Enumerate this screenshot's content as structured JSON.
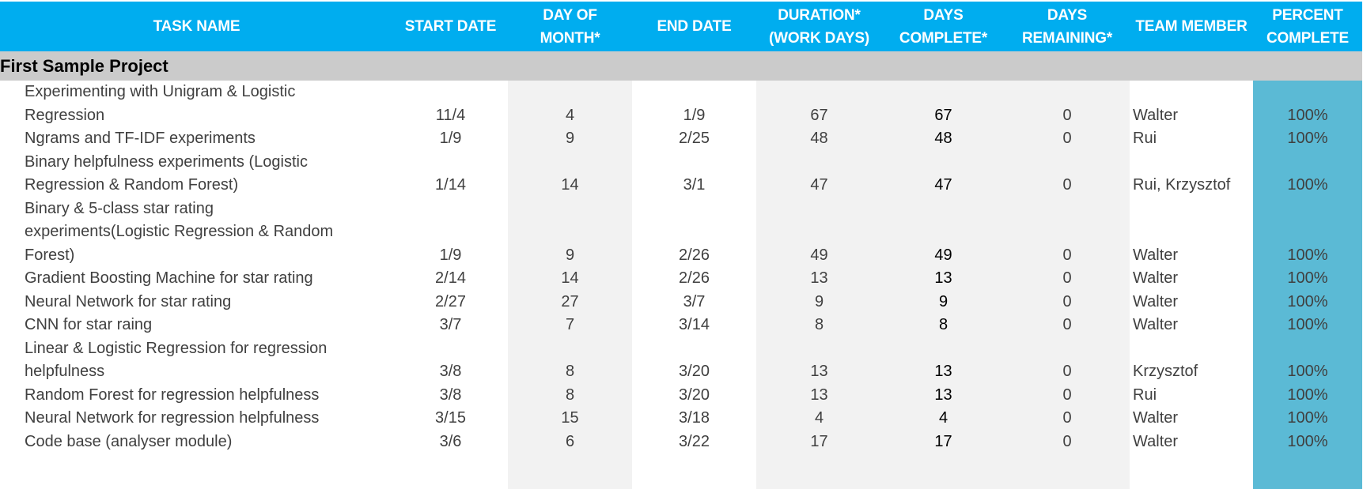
{
  "colors": {
    "header_bg": "#00adef",
    "project_row_bg": "#cbcbcb",
    "stripe_gray": "#f2f2f2",
    "percent_column_bg": "#5bbad5"
  },
  "columns": [
    {
      "key": "task",
      "label": "TASK NAME"
    },
    {
      "key": "start",
      "label": "START DATE"
    },
    {
      "key": "day",
      "label": "DAY OF MONTH*"
    },
    {
      "key": "end",
      "label": "END DATE"
    },
    {
      "key": "duration",
      "label": "DURATION* (WORK DAYS)"
    },
    {
      "key": "complete",
      "label": "DAYS COMPLETE*"
    },
    {
      "key": "remaining",
      "label": "DAYS REMAINING*"
    },
    {
      "key": "member",
      "label": "TEAM MEMBER"
    },
    {
      "key": "percent",
      "label": "PERCENT COMPLETE"
    }
  ],
  "header_lines": {
    "task": [
      "TASK NAME"
    ],
    "start": [
      "START DATE"
    ],
    "day": [
      "DAY OF",
      "MONTH*"
    ],
    "end": [
      "END DATE"
    ],
    "duration": [
      "DURATION*",
      "(WORK DAYS)"
    ],
    "complete": [
      "DAYS",
      "COMPLETE*"
    ],
    "remaining": [
      "DAYS",
      "REMAINING*"
    ],
    "member": [
      "TEAM MEMBER"
    ],
    "percent": [
      "PERCENT",
      "COMPLETE"
    ]
  },
  "project": {
    "title": "First Sample Project"
  },
  "tasks": [
    {
      "task_lines": [
        "Experimenting with Unigram & Logistic",
        "Regression"
      ],
      "start": "11/4",
      "day": "4",
      "end": "1/9",
      "duration": "67",
      "complete": "67",
      "remaining": "0",
      "member": "Walter",
      "percent": "100%"
    },
    {
      "task_lines": [
        "Ngrams and TF-IDF experiments"
      ],
      "start": "1/9",
      "day": "9",
      "end": "2/25",
      "duration": "48",
      "complete": "48",
      "remaining": "0",
      "member": "Rui",
      "percent": "100%"
    },
    {
      "task_lines": [
        "Binary helpfulness experiments (Logistic",
        "Regression & Random Forest)"
      ],
      "start": "1/14",
      "day": "14",
      "end": "3/1",
      "duration": "47",
      "complete": "47",
      "remaining": "0",
      "member": "Rui, Krzysztof",
      "percent": "100%"
    },
    {
      "task_lines": [
        "Binary & 5-class star rating",
        "experiments(Logistic Regression & Random",
        "Forest)"
      ],
      "start": "1/9",
      "day": "9",
      "end": "2/26",
      "duration": "49",
      "complete": "49",
      "remaining": "0",
      "member": "Walter",
      "percent": "100%"
    },
    {
      "task_lines": [
        "Gradient Boosting Machine for star rating"
      ],
      "start": "2/14",
      "day": "14",
      "end": "2/26",
      "duration": "13",
      "complete": "13",
      "remaining": "0",
      "member": "Walter",
      "percent": "100%"
    },
    {
      "task_lines": [
        "Neural Network for star rating"
      ],
      "start": "2/27",
      "day": "27",
      "end": "3/7",
      "duration": "9",
      "complete": "9",
      "remaining": "0",
      "member": "Walter",
      "percent": "100%"
    },
    {
      "task_lines": [
        "CNN for star raing"
      ],
      "start": "3/7",
      "day": "7",
      "end": "3/14",
      "duration": "8",
      "complete": "8",
      "remaining": "0",
      "member": "Walter",
      "percent": "100%"
    },
    {
      "task_lines": [
        "Linear & Logistic Regression for regression",
        "helpfulness"
      ],
      "start": "3/8",
      "day": "8",
      "end": "3/20",
      "duration": "13",
      "complete": "13",
      "remaining": "0",
      "member": "Krzysztof",
      "percent": "100%"
    },
    {
      "task_lines": [
        "Random Forest for regression helpfulness"
      ],
      "start": "3/8",
      "day": "8",
      "end": "3/20",
      "duration": "13",
      "complete": "13",
      "remaining": "0",
      "member": "Rui",
      "percent": "100%"
    },
    {
      "task_lines": [
        "Neural Network for regression helpfulness"
      ],
      "start": "3/15",
      "day": "15",
      "end": "3/18",
      "duration": "4",
      "complete": "4",
      "remaining": "0",
      "member": "Walter",
      "percent": "100%"
    },
    {
      "task_lines": [
        "Code base (analyser module)"
      ],
      "start": "3/6",
      "day": "6",
      "end": "3/22",
      "duration": "17",
      "complete": "17",
      "remaining": "0",
      "member": "Walter",
      "percent": "100%"
    }
  ]
}
